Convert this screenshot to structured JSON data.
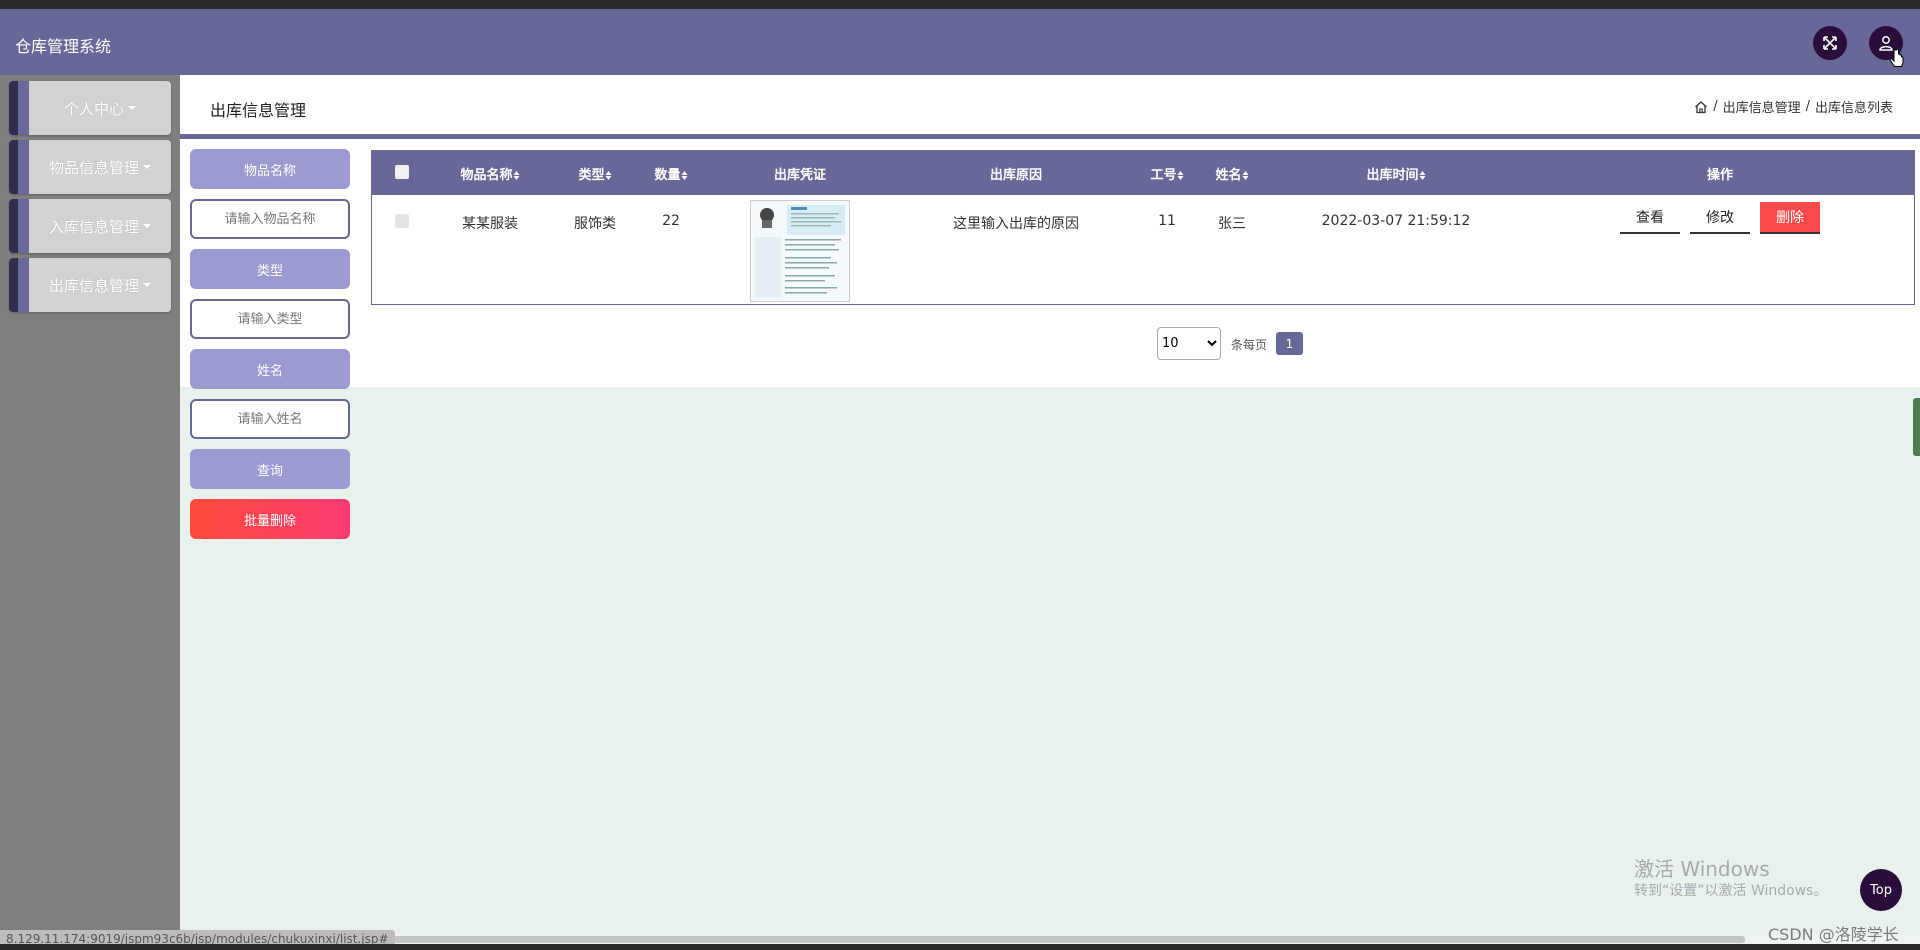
{
  "app": {
    "title": "仓库管理系统"
  },
  "header_icons": {
    "fullscreen": "fullscreen-icon",
    "user": "user-icon"
  },
  "sidebar": {
    "items": [
      {
        "label": "个人中心"
      },
      {
        "label": "物品信息管理"
      },
      {
        "label": "入库信息管理"
      },
      {
        "label": "出库信息管理"
      }
    ]
  },
  "page": {
    "title": "出库信息管理",
    "breadcrumb": [
      "出库信息管理",
      "出库信息列表"
    ]
  },
  "search": {
    "fields": [
      {
        "label": "物品名称",
        "placeholder": "请输入物品名称"
      },
      {
        "label": "类型",
        "placeholder": "请输入类型"
      },
      {
        "label": "姓名",
        "placeholder": "请输入姓名"
      }
    ],
    "query_label": "查询",
    "batch_delete_label": "批量删除"
  },
  "table": {
    "columns": [
      "物品名称",
      "类型",
      "数量",
      "出库凭证",
      "出库原因",
      "工号",
      "姓名",
      "出库时间",
      "操作"
    ],
    "rows": [
      {
        "name": "某某服装",
        "type": "服饰类",
        "quantity": "22",
        "reason": "这里输入出库的原因",
        "job_no": "11",
        "person": "张三",
        "time": "2022-03-07 21:59:12",
        "actions": [
          "查看",
          "修改",
          "删除"
        ]
      }
    ]
  },
  "pagination": {
    "page_size": "10",
    "page_size_options": [
      "10"
    ],
    "per_page_label": "条每页",
    "current_page": "1"
  },
  "overlay": {
    "activate_title": "激活 Windows",
    "activate_sub": "转到“设置”以激活 Windows。",
    "top_button": "Top",
    "status_url": "8.129.11.174:9019/jspm93c6b/jsp/modules/chukuxinxi/list.jsp#",
    "csdn": "CSDN @洛陵学长"
  },
  "colors": {
    "primary": "#686898",
    "button": "#9b9bd2",
    "danger": "#fe4a4a",
    "dark": "#2a0d3a"
  }
}
